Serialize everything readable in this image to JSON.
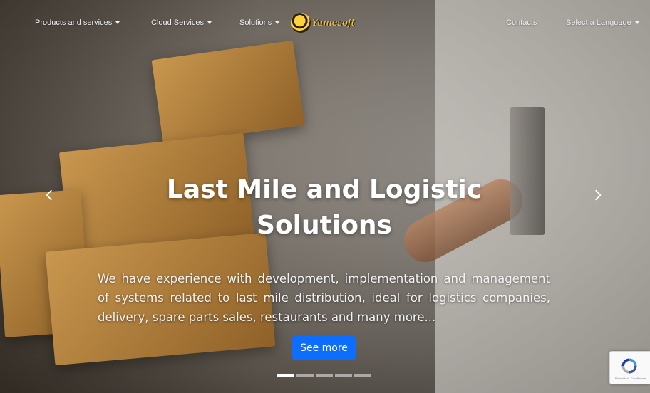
{
  "nav": {
    "items": [
      {
        "label": "Products and services",
        "has_dropdown": true
      },
      {
        "label": "Cloud Services",
        "has_dropdown": true
      },
      {
        "label": "Solutions",
        "has_dropdown": true
      }
    ],
    "right_items": [
      {
        "label": "Contacts",
        "has_dropdown": false
      },
      {
        "label": "Select a Language",
        "has_dropdown": true
      }
    ],
    "logo_text": "Yumesoft",
    "logo_icon": "bee-icon"
  },
  "carousel": {
    "title": "Last Mile and Logistic Solutions",
    "description": "We have experience with development, implementation and management of systems related to last mile distribution, ideal for logistics companies, delivery, spare parts sales, restaurants and many more...",
    "cta_label": "See more",
    "prev_icon": "chevron-left-icon",
    "next_icon": "chevron-right-icon",
    "slide_count": 5,
    "active_slide": 1
  },
  "recaptcha": {
    "icon": "recaptcha-icon",
    "footer_text": "Privacidad - Condiciones"
  },
  "colors": {
    "cta_bg": "#0d6efd",
    "nav_text": "#eef0f2",
    "logo_yellow": "#ffcf26"
  }
}
